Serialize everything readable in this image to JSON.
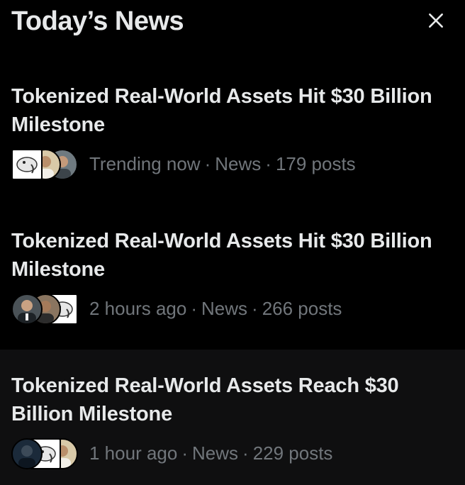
{
  "header": {
    "title": "Today’s News",
    "close_icon": "close-icon"
  },
  "news": [
    {
      "headline": "Tokenized Real-World Assets Hit $30 Billion Milestone",
      "time": "Trending now",
      "category": "News",
      "posts": "179 posts",
      "avatars": [
        "elephant-logo-avatar",
        "person-avatar",
        "person-avatar"
      ]
    },
    {
      "headline": "Tokenized Real-World Assets Hit $30 Billion Milestone",
      "time": "2 hours ago",
      "category": "News",
      "posts": "266 posts",
      "avatars": [
        "person-avatar",
        "person-avatar",
        "elephant-logo-avatar"
      ]
    },
    {
      "headline": "Tokenized Real-World Assets Reach $30 Billion Milestone",
      "time": "1 hour ago",
      "category": "News",
      "posts": "229 posts",
      "avatars": [
        "person-avatar",
        "elephant-logo-avatar",
        "person-avatar"
      ]
    }
  ],
  "colors": {
    "background": "#000000",
    "highlight": "#0f0f10",
    "text_primary": "#e7e9ea",
    "text_secondary": "#71767b"
  }
}
